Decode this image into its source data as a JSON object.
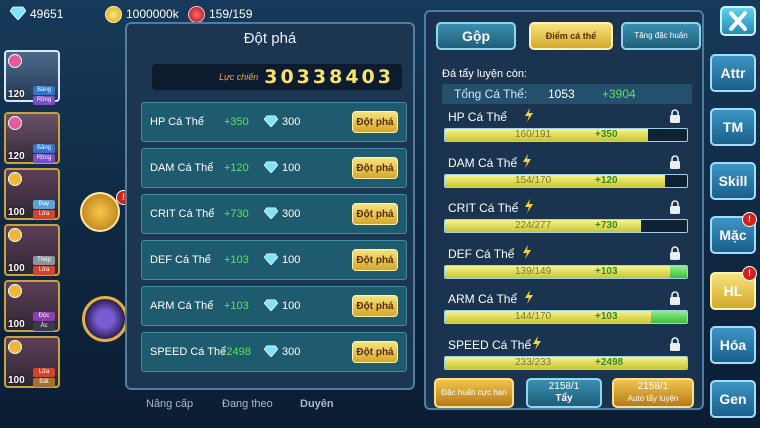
{
  "top": {
    "diamonds": "49651",
    "gold": "1000000k",
    "stamina": "159/159"
  },
  "roster": [
    {
      "level": "120",
      "tags": [
        "Băng",
        "Rồng"
      ],
      "selected": true
    },
    {
      "level": "120",
      "tags": [
        "Băng",
        "Rồng"
      ],
      "selected": false
    },
    {
      "level": "100",
      "tags": [
        "Bay",
        "Lửa"
      ],
      "selected": false
    },
    {
      "level": "100",
      "tags": [
        "Thép",
        "Lửa"
      ],
      "selected": false
    },
    {
      "level": "100",
      "tags": [
        "Độc",
        "Ác"
      ],
      "selected": false
    },
    {
      "level": "100",
      "tags": [
        "Lửa",
        "Đất"
      ],
      "selected": false
    }
  ],
  "breakthrough": {
    "title": "Đột phá",
    "power_label": "Lực chiến",
    "power_value": "30338403",
    "rows": [
      {
        "name": "HP Cá Thể",
        "plus": "+350",
        "cost": "300",
        "button": "Đột phá"
      },
      {
        "name": "DAM Cá Thể",
        "plus": "+120",
        "cost": "100",
        "button": "Đột phá"
      },
      {
        "name": "CRIT Cá Thể",
        "plus": "+730",
        "cost": "300",
        "button": "Đột phá"
      },
      {
        "name": "DEF Cá Thể",
        "plus": "+103",
        "cost": "100",
        "button": "Đột phá"
      },
      {
        "name": "ARM Cá Thể",
        "plus": "+103",
        "cost": "100",
        "button": "Đột phá"
      },
      {
        "name": "SPEED Cá Thể",
        "plus": "+2498",
        "cost": "300",
        "button": "Đột phá"
      }
    ]
  },
  "train": {
    "tabs": [
      "Gộp",
      "Điểm cá thể",
      "Tăng đặc huấn"
    ],
    "stones_label": "Đá tẩy luyện còn:",
    "total_label": "Tổng Cá Thể:",
    "total_value": "1053",
    "total_add": "+3904",
    "stats": [
      {
        "name": "HP Cá Thể",
        "current": "160/191",
        "add": "+350",
        "fill": 0.84,
        "extra": 0.0
      },
      {
        "name": "DAM Cá Thể",
        "current": "154/170",
        "add": "+120",
        "fill": 0.91,
        "extra": 0.0
      },
      {
        "name": "CRIT Cá Thể",
        "current": "224/277",
        "add": "+730",
        "fill": 0.81,
        "extra": 0.0
      },
      {
        "name": "DEF Cá Thể",
        "current": "139/149",
        "add": "+103",
        "fill": 0.93,
        "extra": 0.07
      },
      {
        "name": "ARM Cá Thể",
        "current": "144/170",
        "add": "+103",
        "fill": 0.85,
        "extra": 0.15
      },
      {
        "name": "SPEED Cá Thể",
        "current": "233/233",
        "add": "+2498",
        "fill": 1.0,
        "extra": 0.0
      }
    ],
    "buttons": {
      "special": "Đặc huấn cực hạn",
      "wash_count": "2158/1",
      "wash": "Tẩy",
      "auto_count": "2158/1",
      "auto": "Auto tẩy luyện"
    }
  },
  "nav": [
    "Attr",
    "TM",
    "Skill",
    "Mặc",
    "HL",
    "Hóa",
    "Gen"
  ],
  "footer": [
    "Nâng cấp",
    "Đang theo",
    "Duyên"
  ],
  "colors": {
    "accent_gold": "#d3a92b",
    "accent_blue": "#3d95c4",
    "add_green": "#5be25b"
  }
}
